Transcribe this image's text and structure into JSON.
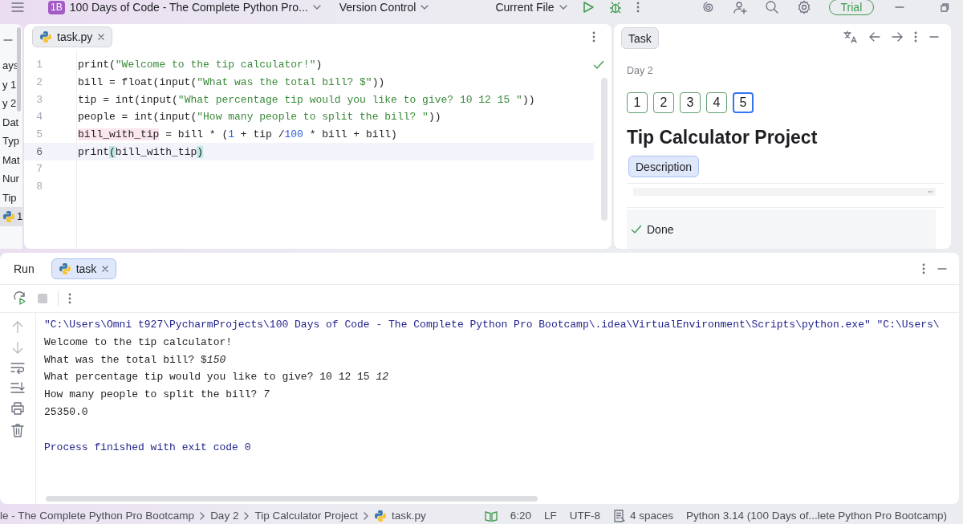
{
  "titlebar": {
    "project_badge": "1B",
    "project": "100 Days of Code - The Complete Python Pro...",
    "vcs": "Version Control",
    "run_config": "Current File",
    "trial": "Trial"
  },
  "sidebar": {
    "items": [
      {
        "label": "ays",
        "kind": "folder",
        "selected": false
      },
      {
        "label": "y 1",
        "kind": "folder",
        "selected": false
      },
      {
        "label": "y 2",
        "kind": "folder",
        "selected": false
      },
      {
        "label": "Dat",
        "kind": "folder",
        "selected": false
      },
      {
        "label": "Typ",
        "kind": "folder",
        "selected": false
      },
      {
        "label": "Mat",
        "kind": "folder",
        "selected": false
      },
      {
        "label": "Nur",
        "kind": "folder",
        "selected": false
      },
      {
        "label": "Tip",
        "kind": "folder",
        "selected": false
      },
      {
        "label": "1",
        "kind": "file",
        "selected": true
      }
    ]
  },
  "editor": {
    "tabs": [
      {
        "label": "task.py",
        "selected": true
      }
    ],
    "lines": [
      {
        "number": "1",
        "current": false,
        "tokens": [
          {
            "text": "print(",
            "kind": "plain"
          },
          {
            "text": "\"Welcome to the tip calculator!\"",
            "kind": "string"
          },
          {
            "text": ")",
            "kind": "plain"
          }
        ]
      },
      {
        "number": "2",
        "current": false,
        "tokens": [
          {
            "text": "bill = float(input(",
            "kind": "plain"
          },
          {
            "text": "\"What was the total bill? $\"",
            "kind": "string"
          },
          {
            "text": "))",
            "kind": "plain"
          }
        ]
      },
      {
        "number": "3",
        "current": false,
        "tokens": [
          {
            "text": "tip = int(input(",
            "kind": "plain"
          },
          {
            "text": "\"What percentage tip would you like to give? 10 12 15 \"",
            "kind": "string"
          },
          {
            "text": "))",
            "kind": "plain"
          }
        ]
      },
      {
        "number": "4",
        "current": false,
        "tokens": [
          {
            "text": "people = int(input(",
            "kind": "plain"
          },
          {
            "text": "\"How many people to split the bill? \"",
            "kind": "string"
          },
          {
            "text": "))",
            "kind": "plain"
          }
        ]
      },
      {
        "number": "5",
        "current": false,
        "tokens": [
          {
            "text": "bill_with_tip",
            "kind": "warn"
          },
          {
            "text": " = bill * (",
            "kind": "plain"
          },
          {
            "text": "1",
            "kind": "number"
          },
          {
            "text": " + tip /",
            "kind": "plain"
          },
          {
            "text": "100",
            "kind": "number"
          },
          {
            "text": " * bill + bill)",
            "kind": "plain"
          }
        ]
      },
      {
        "number": "6",
        "current": true,
        "tokens": [
          {
            "text": "print",
            "kind": "plain"
          },
          {
            "text": "(",
            "kind": "brace"
          },
          {
            "text": "bill_with_tip",
            "kind": "plain"
          },
          {
            "text": ")",
            "kind": "brace"
          }
        ]
      },
      {
        "number": "7",
        "current": false
      },
      {
        "number": "8",
        "current": false
      }
    ]
  },
  "task": {
    "tab": "Task",
    "section": "Day 2",
    "steps": [
      {
        "label": "1",
        "selected": false
      },
      {
        "label": "2",
        "selected": false
      },
      {
        "label": "3",
        "selected": false
      },
      {
        "label": "4",
        "selected": false
      },
      {
        "label": "5",
        "selected": true
      }
    ],
    "title": "Tip Calculator Project",
    "description_button": "Description",
    "status": "Done"
  },
  "run": {
    "title": "Run",
    "tabs": [
      {
        "label": "task",
        "selected": true
      }
    ],
    "console": [
      {
        "kind": "command",
        "text": "\"C:\\Users\\Omni t927\\PycharmProjects\\100 Days of Code - The Complete Python Pro Bootcamp\\.idea\\VirtualEnvironment\\Scripts\\python.exe\" \"C:\\Users\\"
      },
      {
        "kind": "output",
        "text": "Welcome to the tip calculator!"
      },
      {
        "kind": "output",
        "text": "What was the total bill? $*150*"
      },
      {
        "kind": "output",
        "text": "What percentage tip would you like to give? 10 12 15 *12*"
      },
      {
        "kind": "output",
        "text": "How many people to split the bill? *7*"
      },
      {
        "kind": "output",
        "text": "25350.0"
      },
      {
        "kind": "exit",
        "text": "Process finished with exit code 0"
      }
    ]
  },
  "status_bar": {
    "breadcrumbs": [
      {
        "label": "le - The Complete Python Pro Bootcamp",
        "kind": "folder"
      },
      {
        "label": "Day 2",
        "kind": "folder"
      },
      {
        "label": "Tip Calculator Project",
        "kind": "folder"
      },
      {
        "label": "task.py",
        "kind": "file"
      }
    ],
    "position": "6:20",
    "line_ending": "LF",
    "encoding": "UTF-8",
    "indent": "4 spaces",
    "interpreter": "Python 3.14 (100 Days of...lete Python Pro Bootcamp)"
  }
}
